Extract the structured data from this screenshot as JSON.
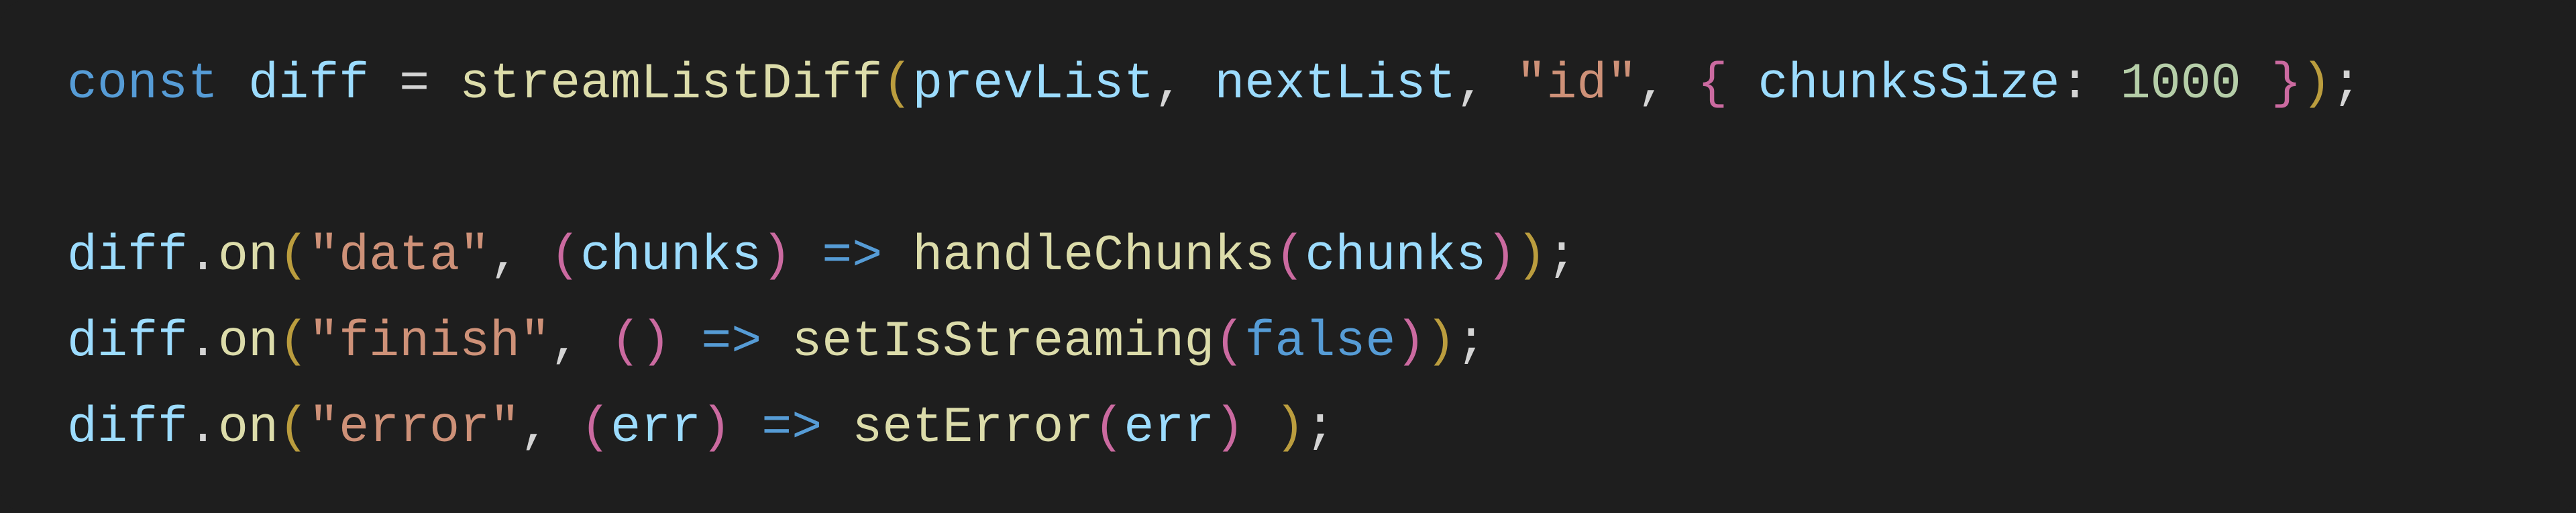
{
  "l1": {
    "const": "const",
    "diff": "diff",
    "eq": " = ",
    "fn": "streamListDiff",
    "op": "(",
    "a1": "prevList",
    "c1": ", ",
    "a2": "nextList",
    "c2": ", ",
    "s1": "\"id\"",
    "c3": ", ",
    "ob": "{ ",
    "prop": "chunksSize",
    "colon": ": ",
    "num": "1000",
    "cb": " }",
    "cp": ")",
    "semi": ";"
  },
  "l3": {
    "obj": "diff",
    "dot": ".",
    "on": "on",
    "op": "(",
    "ev": "\"data\"",
    "c": ", ",
    "po": "(",
    "p": "chunks",
    "pc": ")",
    "ar": " => ",
    "cb": "handleChunks",
    "io": "(",
    "ip": "chunks",
    "ic": ")",
    "cp": ")",
    "semi": ";"
  },
  "l4": {
    "obj": "diff",
    "dot": ".",
    "on": "on",
    "op": "(",
    "ev": "\"finish\"",
    "c": ", ",
    "po": "(",
    "pc": ")",
    "ar": " => ",
    "cb": "setIsStreaming",
    "io": "(",
    "b": "false",
    "ic": ")",
    "cp": ")",
    "semi": ";"
  },
  "l5": {
    "obj": "diff",
    "dot": ".",
    "on": "on",
    "op": "(",
    "ev": "\"error\"",
    "c": ", ",
    "po": "(",
    "p": "err",
    "pc": ")",
    "ar": " => ",
    "cb": "setError",
    "io": "(",
    "ip": "err",
    "ic": ")",
    "sp": " ",
    "cp": ")",
    "semi": ";"
  }
}
